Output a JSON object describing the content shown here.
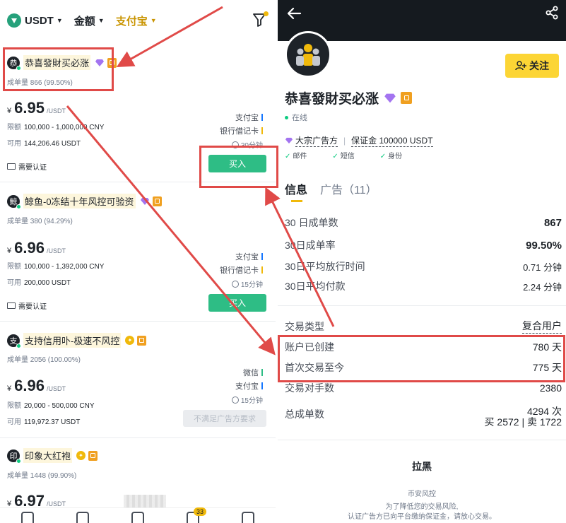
{
  "colors": {
    "accent_yellow": "#f0b90b",
    "buy_green": "#2ebd85",
    "annotation_red": "#e04a48",
    "header_dark": "#151a1f"
  },
  "left": {
    "topbar": {
      "coin": "USDT",
      "amount": "金额",
      "payment": "支付宝"
    },
    "ads": [
      {
        "avatar": "恭",
        "name": "恭喜發財买必涨",
        "stats": "成单量 866 (99.50%)",
        "yen": "¥",
        "price": "6.95",
        "unit": "/USDT",
        "limit_label": "限额",
        "limit": "100,000 - 1,000,000 CNY",
        "avail_label": "可用",
        "avail": "144,206.46 USDT",
        "pay1": "支付宝",
        "pay2": "银行借记卡",
        "time": "30分钟",
        "kyc": "需要认证",
        "action": "买入"
      },
      {
        "avatar": "鲸",
        "name": "鲸鱼-0冻结十年风控可验资",
        "stats": "成单量 380 (94.29%)",
        "yen": "¥",
        "price": "6.96",
        "unit": "/USDT",
        "limit_label": "限额",
        "limit": "100,000 - 1,392,000 CNY",
        "avail_label": "可用",
        "avail": "200,000 USDT",
        "pay1": "支付宝",
        "pay2": "银行借记卡",
        "time": "15分钟",
        "kyc": "需要认证",
        "action": "买入"
      },
      {
        "avatar": "支",
        "name": "支持信用卟-极速不风控",
        "stats": "成单量 2056 (100.00%)",
        "yen": "¥",
        "price": "6.96",
        "unit": "/USDT",
        "limit_label": "限额",
        "limit": "20,000 - 500,000 CNY",
        "avail_label": "可用",
        "avail": "119,972.37 USDT",
        "pay1": "微信",
        "pay2": "支付宝",
        "time": "15分钟",
        "action": "不满足广告方要求"
      },
      {
        "avatar": "印",
        "name": "印象大红袍",
        "stats": "成单量 1448 (99.90%)",
        "yen": "¥",
        "price": "6.97",
        "unit": "/USDT"
      }
    ],
    "nav_badge": "33"
  },
  "right": {
    "follow": "关注",
    "name": "恭喜發財买必涨",
    "status": "在线",
    "tag_bulk": "大宗广告方",
    "tag_deposit": "保证金 100000 USDT",
    "verify": [
      "邮件",
      "短信",
      "身份"
    ],
    "tabs": [
      "信息",
      "广告（11）"
    ],
    "stats": [
      {
        "k": "30 日成单数",
        "v": "867"
      },
      {
        "k": "30日成单率",
        "v": "99.50%"
      },
      {
        "k": "30日平均放行时间",
        "v": "0.71 分钟"
      },
      {
        "k": "30日平均付款",
        "v": "2.24 分钟"
      }
    ],
    "details": [
      {
        "k": "交易类型",
        "v": "复合用户"
      },
      {
        "k": "账户已创建",
        "v": "780 天"
      },
      {
        "k": "首次交易至今",
        "v": "775 天"
      },
      {
        "k": "交易对手数",
        "v": "2380"
      },
      {
        "k": "总成单数",
        "v": "4294 次"
      }
    ],
    "total_sub": "买 2572 | 卖 1722",
    "block": "拉黑",
    "risk_title": "币安风控",
    "risk_line1": "为了降低您的交易风险,",
    "risk_line2": "认证广告方已向平台缴纳保证金，请放心交易。"
  }
}
